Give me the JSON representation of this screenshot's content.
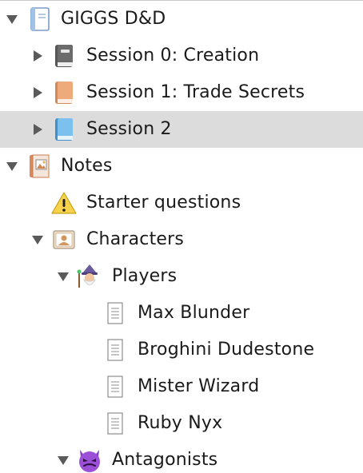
{
  "binder": {
    "items": [
      {
        "label": "GIGGS D&D",
        "icon": "project-notebook-icon",
        "disclosure": "expanded"
      },
      {
        "label": "Session 0: Creation",
        "icon": "book-dark-icon",
        "disclosure": "collapsed"
      },
      {
        "label": "Session 1: Trade Secrets",
        "icon": "book-orange-icon",
        "disclosure": "collapsed"
      },
      {
        "label": "Session 2",
        "icon": "book-blue-icon",
        "disclosure": "collapsed",
        "selected": true
      },
      {
        "label": "Notes",
        "icon": "notebook-photo-icon",
        "disclosure": "expanded"
      },
      {
        "label": "Starter questions",
        "icon": "warning-icon",
        "disclosure": "none"
      },
      {
        "label": "Characters",
        "icon": "contact-card-icon",
        "disclosure": "expanded"
      },
      {
        "label": "Players",
        "icon": "mage-emoji-icon",
        "disclosure": "expanded"
      },
      {
        "label": "Max Blunder",
        "icon": "document-icon",
        "disclosure": "none"
      },
      {
        "label": "Broghini Dudestone",
        "icon": "document-icon",
        "disclosure": "none"
      },
      {
        "label": "Mister Wizard",
        "icon": "document-icon",
        "disclosure": "none"
      },
      {
        "label": "Ruby Nyx",
        "icon": "document-icon",
        "disclosure": "none"
      },
      {
        "label": "Antagonists",
        "icon": "devil-emoji-icon",
        "disclosure": "expanded"
      }
    ]
  },
  "colors": {
    "selection": "#dcdcdc",
    "disclosure": "#5a5a5a",
    "text": "#1a1a1a"
  }
}
